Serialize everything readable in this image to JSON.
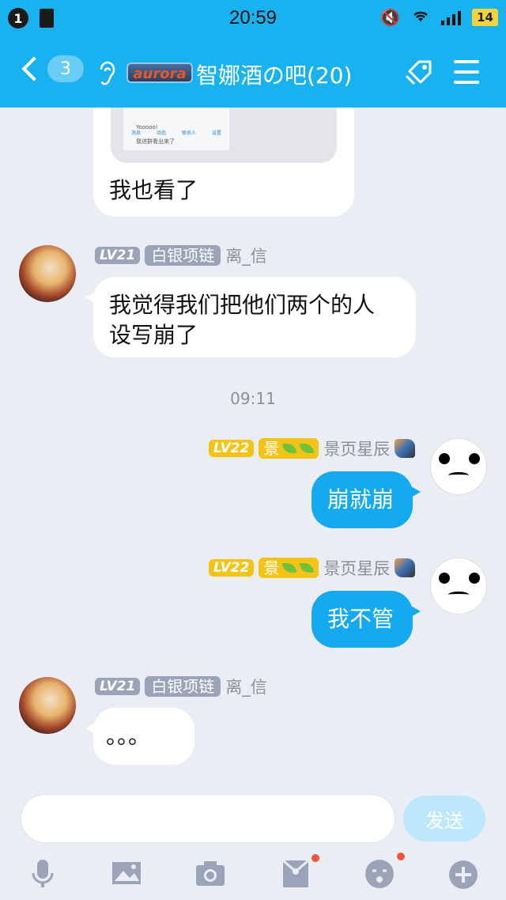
{
  "status_bar": {
    "notification_count": "1",
    "time": "20:59",
    "battery": "14"
  },
  "nav": {
    "back_count": "3",
    "logo_text": "aurora",
    "title": "智娜酒の吧(20)"
  },
  "image_message": {
    "preview_line1": "Yooooo!",
    "preview_line2": "我进群看出来了",
    "preview_tabs": [
      "消息",
      "动态",
      "联系人",
      "设置"
    ]
  },
  "messages": [
    {
      "side": "left",
      "text": "我也看了"
    },
    {
      "side": "left",
      "level": "LV21",
      "title": "白银项链",
      "nick": "离_信",
      "text_line1": "我觉得我们把他们两个的人",
      "text_line2": "设写崩了"
    },
    {
      "timestamp": "09:11"
    },
    {
      "side": "right",
      "level": "LV22",
      "title": "景",
      "nick": "景页星辰",
      "text": "崩就崩"
    },
    {
      "side": "right",
      "level": "LV22",
      "title": "景",
      "nick": "景页星辰",
      "text": "我不管"
    },
    {
      "side": "left",
      "level": "LV21",
      "title": "白银项链",
      "nick": "离_信",
      "text": "。。。"
    }
  ],
  "input": {
    "send_label": "发送"
  },
  "toolbar_icons": [
    "microphone-icon",
    "image-icon",
    "camera-icon",
    "red-packet-icon",
    "emoji-icon",
    "plus-icon"
  ],
  "colors": {
    "primary": "#19b2f0",
    "bubble_right": "#15aaf0",
    "background": "#eaedf3",
    "badge_red": "#f2553a",
    "level_gold": "#f3c416",
    "level_grey": "#9aa3b8"
  }
}
